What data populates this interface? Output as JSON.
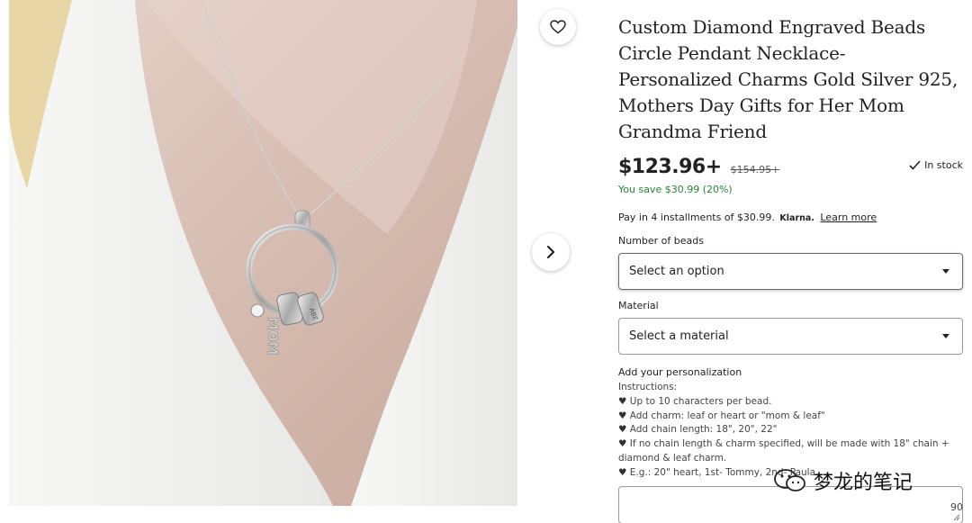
{
  "product": {
    "title": "Custom Diamond Engraved Beads Circle Pendant Necklace- Personalized Charms Gold Silver 925, Mothers Day Gifts for Her Mom Grandma Friend",
    "price": "$123.96+",
    "original_price": "$154.95+",
    "stock_status": "In stock",
    "savings": "You save $30.99 (20%)"
  },
  "klarna": {
    "text": "Pay in 4 installments of $30.99.",
    "brand": "Klarna.",
    "link": "Learn more"
  },
  "options": {
    "beads_label": "Number of beads",
    "beads_placeholder": "Select an option",
    "material_label": "Material",
    "material_placeholder": "Select a material"
  },
  "personalization": {
    "title": "Add your personalization",
    "instructions_heading": "Instructions:",
    "lines": [
      "Up to 10 characters per bead.",
      "Add charm: leaf or heart or \"mom & leaf\"",
      "Add chain length: 18\", 20\", 22\"",
      "If no chain length & charm specified, will be made with 18\" chain + diamond & leaf charm.",
      "E.g.: 20\" heart, 1st- Tommy, 2nd- Paula"
    ],
    "bullet": "♥",
    "char_count": "90"
  },
  "photo": {
    "engraving_vertical": "MOM",
    "engraving_beads": "ABE"
  },
  "watermark": {
    "text": "梦龙的笔记"
  },
  "icons": {
    "favorite": "heart-outline-icon",
    "next": "chevron-right-icon",
    "stock": "check-icon",
    "resize": "resize-handle-icon",
    "watermark": "wechat-icon"
  },
  "colors": {
    "savings_green": "#258635",
    "text": "#222222",
    "border": "#9a9a9a"
  }
}
